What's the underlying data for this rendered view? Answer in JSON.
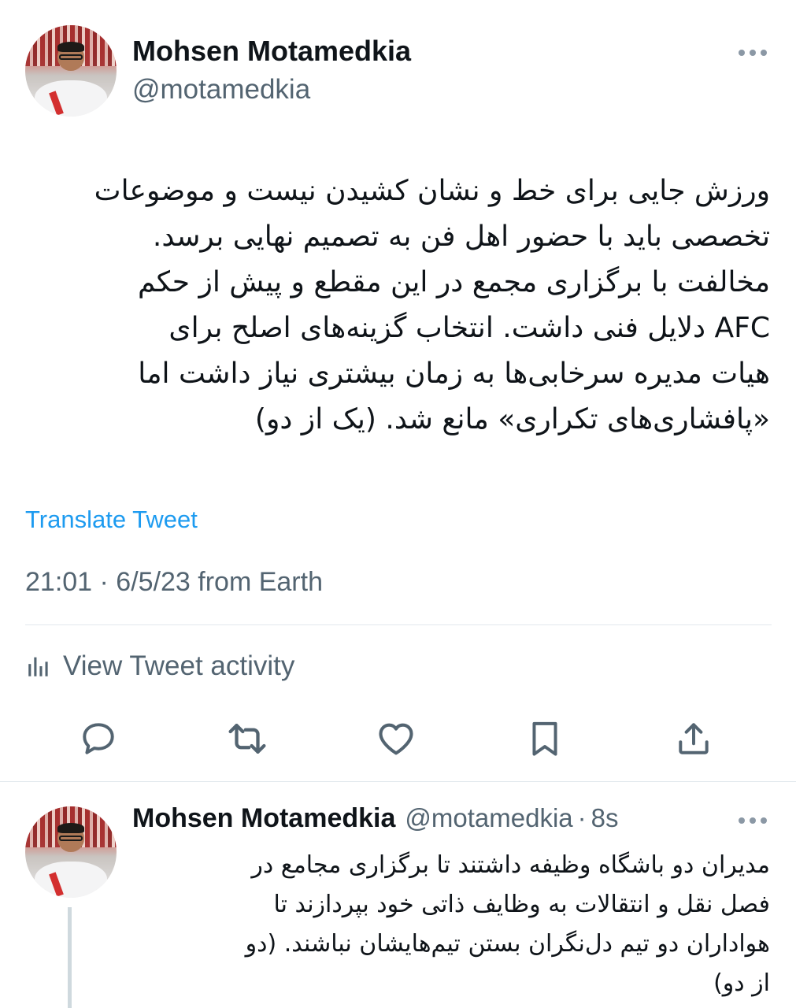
{
  "tweet": {
    "author": {
      "display_name": "Mohsen Motamedkia",
      "handle": "@motamedkia"
    },
    "text_lines": [
      "ورزش جایی برای خط و نشان کشیدن نیست و موضوعات",
      "تخصصی باید با حضور اهل فن به تصمیم نهایی برسد.",
      "مخالفت با برگزاری مجمع در این مقطع و پیش از حکم",
      "AFC دلایل فنی داشت. انتخاب گزینه‌های اصلح برای",
      "هیات مدیره سرخابی‌ها به زمان بیشتری نیاز داشت اما",
      "«پافشاری‌های تکراری» مانع شد. (یک از دو)"
    ],
    "translate_label": "Translate Tweet",
    "timestamp": "21:01 · 6/5/23 from Earth",
    "activity_label": "View Tweet activity"
  },
  "actions": [
    {
      "name": "reply",
      "icon": "reply-icon"
    },
    {
      "name": "retweet",
      "icon": "retweet-icon"
    },
    {
      "name": "like",
      "icon": "heart-icon"
    },
    {
      "name": "bookmark",
      "icon": "bookmark-icon"
    },
    {
      "name": "share",
      "icon": "share-icon"
    }
  ],
  "reply": {
    "author": {
      "display_name": "Mohsen Motamedkia",
      "handle": "@motamedkia"
    },
    "separator": "·",
    "time": "8s",
    "text_lines": [
      "مدیران دو باشگاه وظیفه داشتند تا برگزاری مجامع در",
      "فصل نقل و انتقالات به وظایف ذاتی خود بپردازند تا",
      "هواداران دو تیم دل‌نگران بستن تیم‌هایشان نباشند. (دو",
      "از دو)"
    ]
  },
  "colors": {
    "text": "#0f1419",
    "secondary": "#536471",
    "link": "#1d9bf0",
    "divider": "#e1e8ed",
    "icon": "#536471"
  }
}
